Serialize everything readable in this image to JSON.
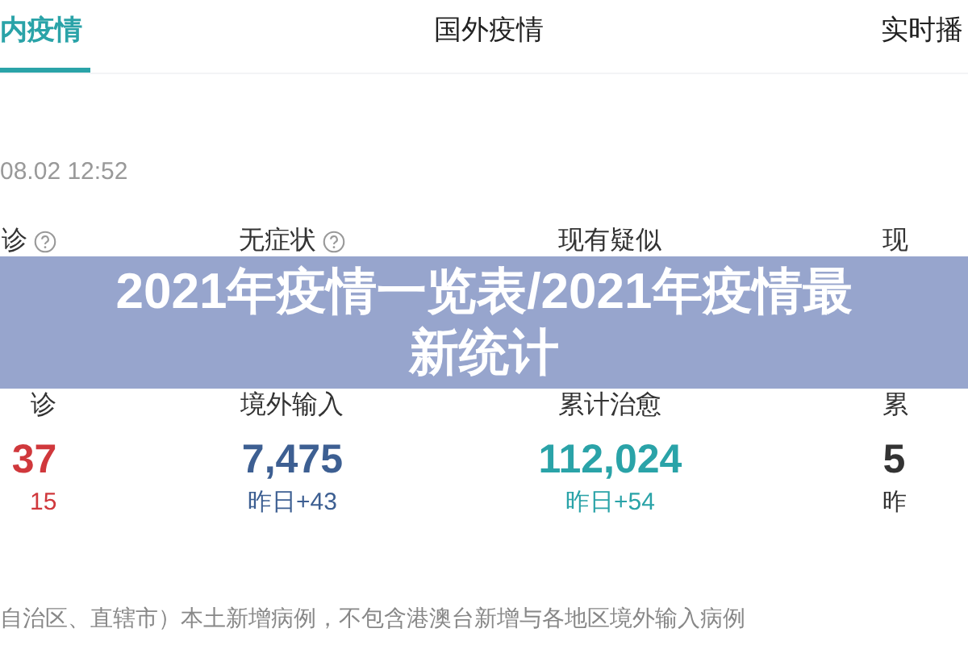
{
  "tabs": [
    {
      "label": "内疫情",
      "selected": true
    },
    {
      "label": "国外疫情",
      "selected": false
    },
    {
      "label": "实时播",
      "selected": false
    }
  ],
  "updated": "08.02 12:52",
  "stat_rows": [
    [
      {
        "label": "诊",
        "help": true
      },
      {
        "label": "无症状",
        "help": true
      },
      {
        "label": "现有疑似",
        "help": false
      },
      {
        "label": "现",
        "help": false
      }
    ],
    [
      {
        "label": "诊",
        "help": false,
        "value": "37",
        "delta": "15",
        "color": "#d0383c"
      },
      {
        "label": "境外输入",
        "help": false,
        "value": "7,475",
        "delta": "昨日+43",
        "color": "#3d5f92"
      },
      {
        "label": "累计治愈",
        "help": false,
        "value": "112,024",
        "delta": "昨日+54",
        "color": "#2aa3a8"
      },
      {
        "label": "累",
        "help": false,
        "value": "5",
        "delta": "昨",
        "color": "#333333"
      }
    ]
  ],
  "footnote": "自治区、直辖市）本土新增病例，不包含港澳台新增与各地区境外输入病例",
  "overlay_title": "2021年疫情一览表/2021年疫情最新统计"
}
